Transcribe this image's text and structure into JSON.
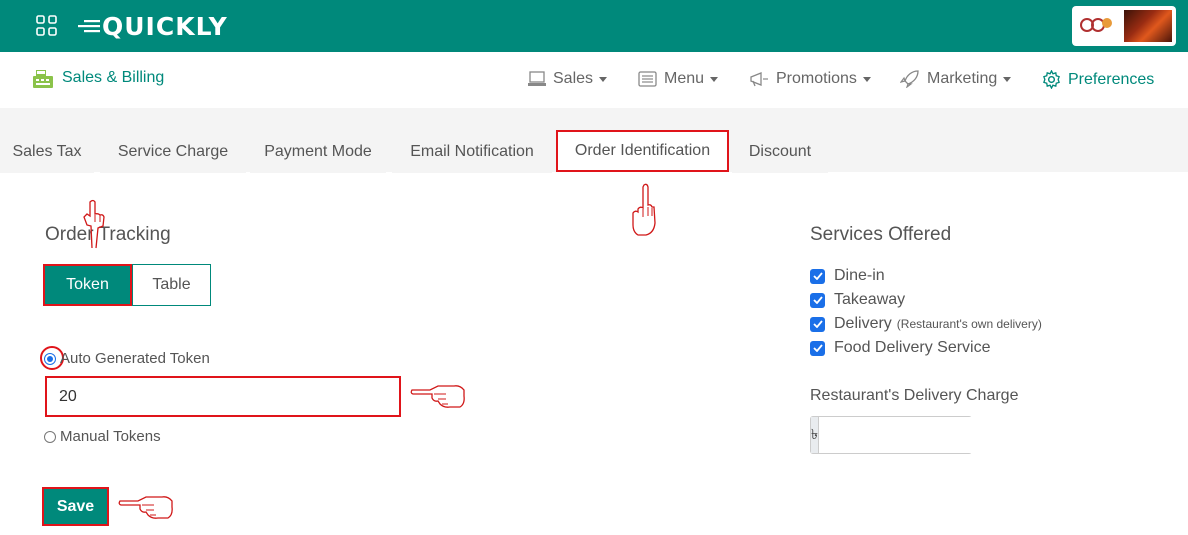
{
  "header": {
    "logo_text": "QUICKLY",
    "brand_colors": {
      "primary": "#00897b",
      "highlight": "#e0141a",
      "check": "#1a6fe8"
    }
  },
  "subnav": {
    "module_label": "Sales & Billing",
    "items": [
      {
        "label": "Sales",
        "icon": "laptop-icon",
        "dropdown": true
      },
      {
        "label": "Menu",
        "icon": "menu-list-icon",
        "dropdown": true
      },
      {
        "label": "Promotions",
        "icon": "megaphone-icon",
        "dropdown": true
      },
      {
        "label": "Marketing",
        "icon": "rocket-icon",
        "dropdown": true
      },
      {
        "label": "Preferences",
        "icon": "gear-icon",
        "dropdown": false
      }
    ]
  },
  "tabs": [
    {
      "label": "Sales Tax",
      "active": false
    },
    {
      "label": "Service Charge",
      "active": false
    },
    {
      "label": "Payment Mode",
      "active": false
    },
    {
      "label": "Email Notification",
      "active": false
    },
    {
      "label": "Order Identification",
      "active": true
    },
    {
      "label": "Discount",
      "active": false
    }
  ],
  "order_tracking": {
    "title": "Order Tracking",
    "options": [
      "Token",
      "Table"
    ],
    "selected": "Token",
    "auto_label": "Auto Generated Token",
    "auto_value": "20",
    "manual_label": "Manual Tokens",
    "save_label": "Save"
  },
  "services": {
    "title": "Services Offered",
    "items": [
      {
        "label": "Dine-in",
        "note": "",
        "checked": true
      },
      {
        "label": "Takeaway",
        "note": "",
        "checked": true
      },
      {
        "label": "Delivery",
        "note": "(Restaurant's own delivery)",
        "checked": true
      },
      {
        "label": "Food Delivery Service",
        "note": "",
        "checked": true
      }
    ],
    "charge_label": "Restaurant's Delivery Charge",
    "currency_symbol": "৳",
    "charge_value": ""
  }
}
